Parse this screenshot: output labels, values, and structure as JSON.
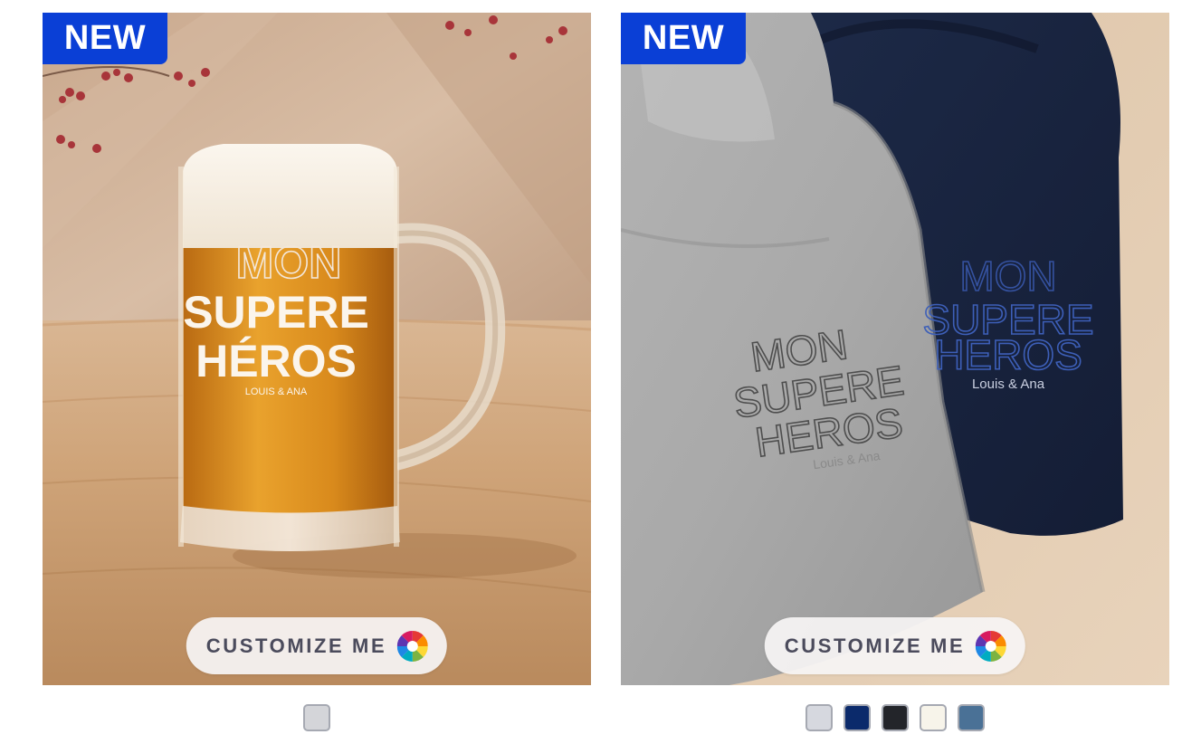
{
  "products": [
    {
      "badge": "NEW",
      "customize_label": "CUSTOMIZE ME",
      "image": {
        "print_line1": "MON",
        "print_line2": "SUPERE",
        "print_line3": "HÉROS",
        "print_line4": "LOUIS & ANA"
      },
      "swatches": [
        {
          "name": "clear",
          "color": "#d4d5d9"
        }
      ]
    },
    {
      "badge": "NEW",
      "customize_label": "CUSTOMIZE ME",
      "image": {
        "grey_line1": "MON",
        "grey_line2": "SUPERE",
        "grey_line3": "HEROS",
        "grey_line4": "Louis & Ana",
        "navy_line1": "MON",
        "navy_line2": "SUPERE",
        "navy_line3": "HEROS",
        "navy_line4": "Louis & Ana"
      },
      "swatches": [
        {
          "name": "heather-grey",
          "color": "#d6d8df"
        },
        {
          "name": "navy",
          "color": "#0b2a6b"
        },
        {
          "name": "black",
          "color": "#23252a"
        },
        {
          "name": "cream",
          "color": "#f7f4ea"
        },
        {
          "name": "steel-blue",
          "color": "#4a7196"
        }
      ]
    }
  ]
}
